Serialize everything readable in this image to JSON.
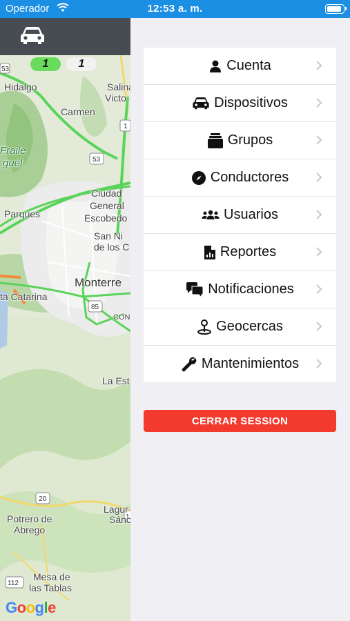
{
  "status_bar": {
    "carrier": "Operador",
    "time": "12:53 a. m."
  },
  "map": {
    "pill_active": "1",
    "pill_inactive": "1",
    "labels": {
      "hidalgo": "Hidalgo",
      "salinas": "Salina",
      "victoria": "Victo",
      "carmen": "Carmen",
      "fraile": "Fraile",
      "guel": "guel",
      "ciudad": "Ciudad",
      "general": "General",
      "escobedo": "Escobedo",
      "parques": "Parques",
      "san_nic": "San Ni",
      "de_los": "de los C",
      "monterrey": "Monterre",
      "santa_catarina": "ta Catarina",
      "la_estanzuela": "La Est",
      "laguna": "Lagur",
      "sanchez": "Sánc",
      "potrero": "Potrero de",
      "abrego": "Abrego",
      "mesa": "Mesa de",
      "tablas": "las Tablas",
      "con": "CON"
    },
    "shields": {
      "s53": "53",
      "s1": "1",
      "s53b": "53",
      "s85": "85",
      "s20": "20",
      "s112": "112",
      "s1b": "1"
    },
    "google": [
      "G",
      "o",
      "o",
      "g",
      "l",
      "e"
    ]
  },
  "menu": {
    "items": [
      {
        "label": "Cuenta",
        "icon": "user-icon"
      },
      {
        "label": "Dispositivos",
        "icon": "car-icon"
      },
      {
        "label": "Grupos",
        "icon": "layers-icon"
      },
      {
        "label": "Conductores",
        "icon": "compass-icon"
      },
      {
        "label": "Usuarios",
        "icon": "users-icon"
      },
      {
        "label": "Reportes",
        "icon": "report-icon"
      },
      {
        "label": "Notificaciones",
        "icon": "comments-icon"
      },
      {
        "label": "Geocercas",
        "icon": "pin-icon"
      },
      {
        "label": "Mantenimientos",
        "icon": "wrench-icon"
      }
    ]
  },
  "logout_label": "CERRAR SESSION",
  "colors": {
    "status_bar": "#1a8fe3",
    "topbar": "#474b52",
    "logout": "#f23a2f",
    "route_green": "#5ad35a",
    "pill_active": "#69dc5d"
  }
}
